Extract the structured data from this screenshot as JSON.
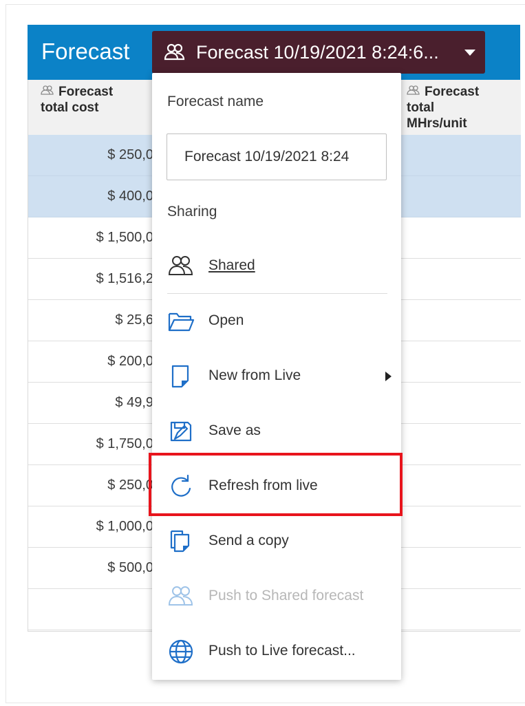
{
  "header": {
    "title": "Forecast",
    "selector_label": "Forecast 10/19/2021 8:24:6..."
  },
  "table": {
    "columns": [
      {
        "line1": "Forecast",
        "line2": "total cost"
      },
      {
        "line1": "Forecast",
        "line2": "total",
        "line3": "MHrs/unit"
      }
    ],
    "rows": [
      {
        "value": "$ 250,0",
        "selected": true
      },
      {
        "value": "$ 400,0",
        "selected": true
      },
      {
        "value": "$ 1,500,0",
        "selected": false
      },
      {
        "value": "$ 1,516,2",
        "selected": false
      },
      {
        "value": "$ 25,6",
        "selected": false
      },
      {
        "value": "$ 200,0",
        "selected": false
      },
      {
        "value": "$ 49,9",
        "selected": false
      },
      {
        "value": "$ 1,750,0",
        "selected": false
      },
      {
        "value": "$ 250,0",
        "selected": false
      },
      {
        "value": "$ 1,000,0",
        "selected": false
      },
      {
        "value": "$ 500,0",
        "selected": false
      },
      {
        "value": "",
        "selected": false
      }
    ]
  },
  "menu": {
    "forecast_name_label": "Forecast name",
    "forecast_name_value": "Forecast 10/19/2021 8:24",
    "sharing_label": "Sharing",
    "items": {
      "shared": "Shared",
      "open": "Open",
      "new_from_live": "New from Live",
      "save_as": "Save as",
      "refresh_from_live": "Refresh from live",
      "send_a_copy": "Send a copy",
      "push_to_shared": "Push to Shared forecast",
      "push_to_live": "Push to Live forecast..."
    }
  },
  "colors": {
    "header_blue": "#0b82c7",
    "selector_maroon": "#4a1f2d",
    "selected_row": "#cfe0f1",
    "icon_blue": "#1f6fc8",
    "highlight_red": "#e8141c"
  },
  "icons": [
    "people-icon",
    "folder-open-icon",
    "new-document-icon",
    "save-as-icon",
    "refresh-icon",
    "copy-icon",
    "globe-icon",
    "caret-down-icon",
    "submenu-arrow-icon"
  ]
}
